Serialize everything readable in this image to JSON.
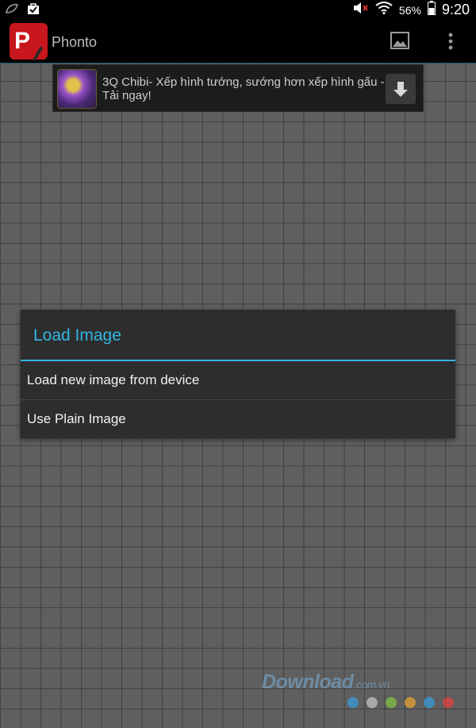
{
  "status_bar": {
    "battery_percent": "56%",
    "time": "9:20"
  },
  "app_bar": {
    "app_icon_letter": "P",
    "title": "Phonto"
  },
  "ad": {
    "text": "3Q Chibi- Xếp hình tướng, sướng hơn xếp hình gấu - Tải ngay!"
  },
  "dialog": {
    "title": "Load Image",
    "items": [
      {
        "label": "Load new image from device"
      },
      {
        "label": "Use Plain Image"
      }
    ]
  },
  "watermark": {
    "text": "Download",
    "suffix": ".com.vn",
    "dot_colors": [
      "#3a9ad9",
      "#bfbfbf",
      "#7fbf3f",
      "#e0a030",
      "#3a9ad9",
      "#e04040"
    ]
  },
  "colors": {
    "accent": "#33b5e5",
    "app_icon": "#c8161d"
  }
}
